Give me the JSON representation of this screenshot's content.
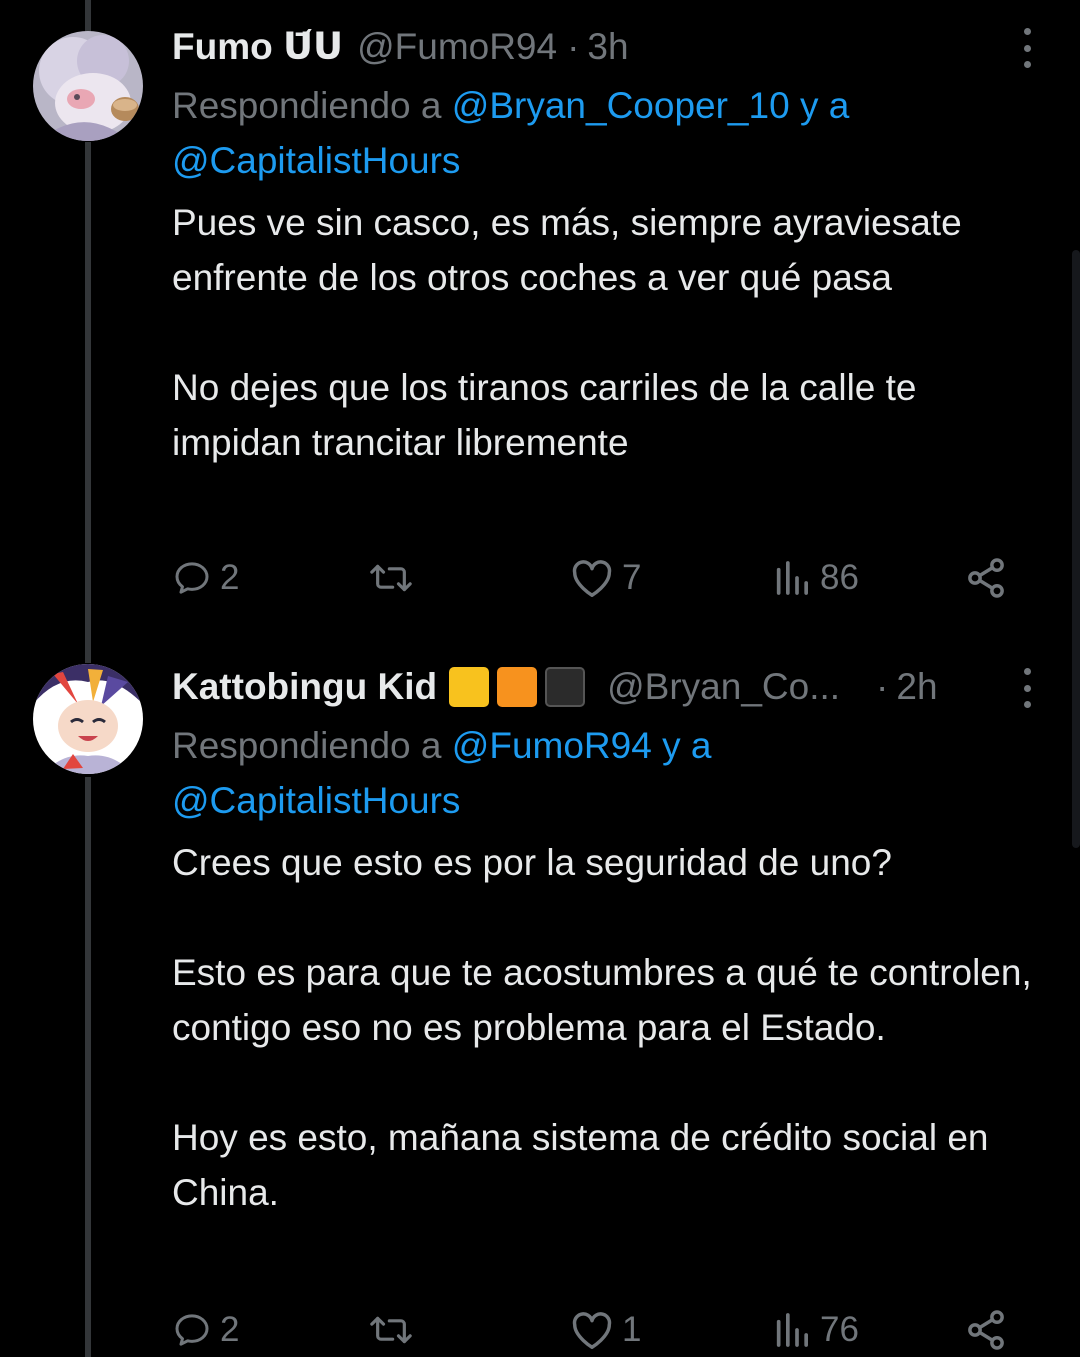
{
  "tweets": [
    {
      "display_name": "Fumo ᑌ᷄ᑌ",
      "handle": "@FumoR94",
      "dot": "·",
      "time": "3h",
      "reply_prefix": "Respondiendo a ",
      "reply_mention_1": "@Bryan_Cooper_10 y a",
      "reply_mention_2": "@CapitalistHours",
      "paragraphs": [
        "Pues ve sin casco, es más, siempre ayraviesate enfrente de los otros coches a ver qué pasa",
        "No dejes que los tiranos carriles de la calle te impidan trancitar libremente"
      ],
      "replies": "2",
      "retweets": "",
      "likes": "7",
      "views": "86"
    },
    {
      "display_name": "Kattobingu Kid",
      "handle": "@Bryan_Co...",
      "dot": "·",
      "time": "2h",
      "reply_prefix": "Respondiendo a ",
      "reply_mention_1": "@FumoR94 y a",
      "reply_mention_2": "@CapitalistHours",
      "paragraphs": [
        "Crees que esto es por la seguridad de uno?",
        "Esto es para que te acostumbres a qué te controlen, contigo eso no es problema para el Estado.",
        "Hoy es esto, mañana sistema de crédito social en China."
      ],
      "replies": "2",
      "retweets": "",
      "likes": "1",
      "views": "76"
    }
  ],
  "badge_colors": [
    "#f8c21e",
    "#f7921e",
    "#2b2b2b"
  ],
  "icons": {
    "reply": "reply-icon",
    "retweet": "retweet-icon",
    "like": "heart-icon",
    "views": "views-icon",
    "share": "share-icon",
    "more": "more-icon"
  },
  "colors": {
    "background": "#000000",
    "text": "#e7e9ea",
    "muted": "#71767b",
    "link": "#1d9bf0"
  }
}
